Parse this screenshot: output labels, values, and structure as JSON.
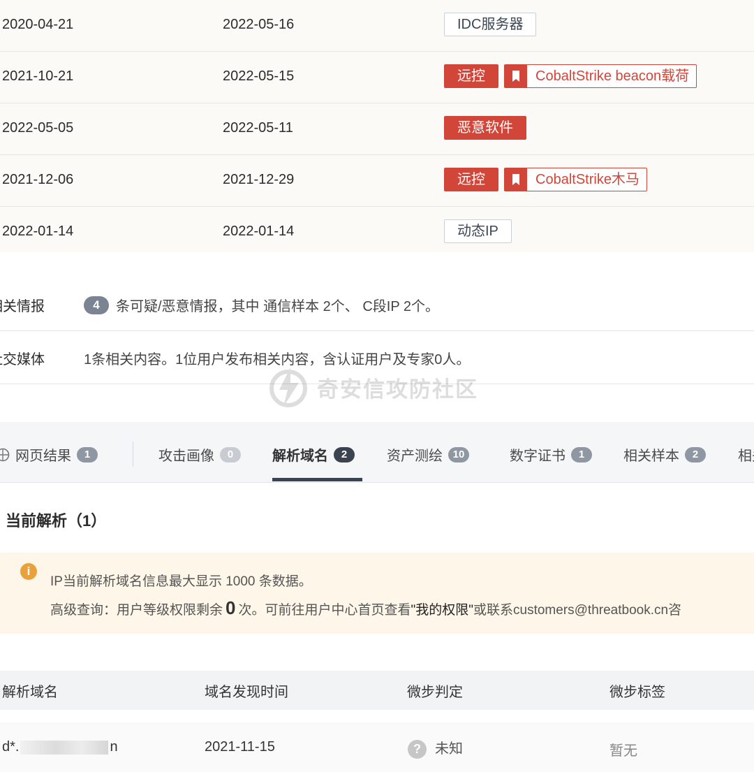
{
  "top_rows": [
    {
      "first_seen": "2020-04-21",
      "last_seen": "2022-05-16",
      "tags": [
        {
          "style": "gray",
          "text": "IDC服务器"
        }
      ]
    },
    {
      "first_seen": "2021-10-21",
      "last_seen": "2022-05-15",
      "tags": [
        {
          "style": "red",
          "text": "远控"
        },
        {
          "style": "redline",
          "text": "CobaltStrike beacon载荷"
        }
      ]
    },
    {
      "first_seen": "2022-05-05",
      "last_seen": "2022-05-11",
      "tags": [
        {
          "style": "red",
          "text": "恶意软件"
        }
      ]
    },
    {
      "first_seen": "2021-12-06",
      "last_seen": "2021-12-29",
      "tags": [
        {
          "style": "red",
          "text": "远控"
        },
        {
          "style": "redline",
          "text": "CobaltStrike木马"
        }
      ]
    },
    {
      "first_seen": "2022-01-14",
      "last_seen": "2022-01-14",
      "tags": [
        {
          "style": "gray",
          "text": "动态IP"
        }
      ]
    }
  ],
  "intel": {
    "related_label": "相关情报",
    "related_count": "4",
    "related_text": "条可疑/恶意情报，其中 通信样本 2个、 C段IP 2个。",
    "social_label": "社交媒体",
    "social_text": "1条相关内容。1位用户发布相关内容，含认证用户及专家0人。"
  },
  "watermark": "奇安信攻防社区",
  "tabs": [
    {
      "label": "网页结果",
      "count": "1"
    },
    {
      "label": "攻击画像",
      "count": "0"
    },
    {
      "label": "解析域名",
      "count": "2"
    },
    {
      "label": "资产测绘",
      "count": "10"
    },
    {
      "label": "数字证书",
      "count": "1"
    },
    {
      "label": "相关样本",
      "count": "2"
    },
    {
      "label": "相关",
      "count": ""
    }
  ],
  "active_tab": "解析域名",
  "section_title": "当前解析（1）",
  "notice": {
    "line1": "IP当前解析域名信息最大显示 1000 条数据。",
    "line2_a": "高级查询：用户等级权限剩余",
    "line2_num": "0",
    "line2_b": "次。可前往用户中心首页查看",
    "line2_em": "\"我的权限\"",
    "line2_c": " 或联系customers@threatbook.cn咨"
  },
  "table": {
    "headers": [
      "解析域名",
      "域名发现时间",
      "微步判定",
      "微步标签"
    ],
    "rows": [
      {
        "domain_prefix": "d*.",
        "domain_suffix": "n",
        "found": "2021-11-15",
        "verdict": "未知",
        "label": "暂无"
      }
    ]
  }
}
